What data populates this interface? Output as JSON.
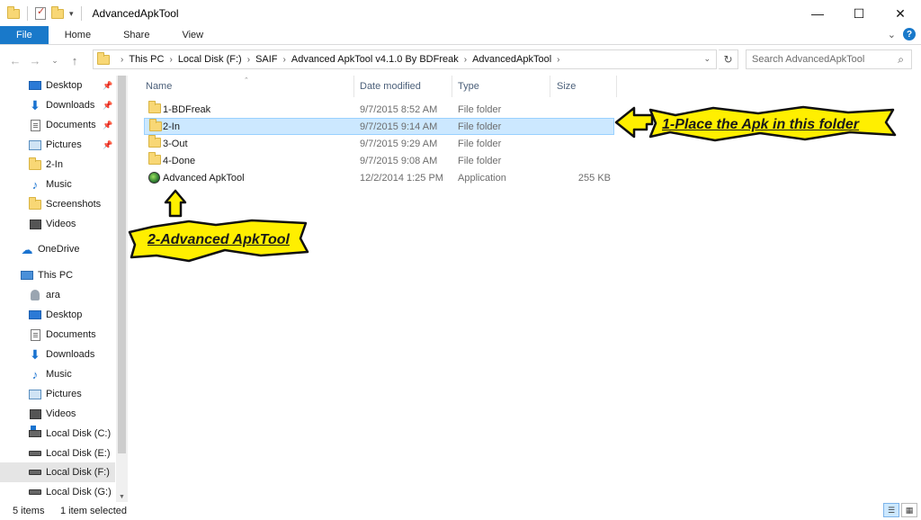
{
  "window": {
    "title": "AdvancedApkTool",
    "controls": {
      "minimize": "—",
      "maximize": "☐",
      "close": "✕"
    }
  },
  "ribbon": {
    "tabs": [
      "File",
      "Home",
      "Share",
      "View"
    ],
    "collapse_icon": "chevron-down-icon",
    "help_label": "?"
  },
  "address": {
    "crumbs": [
      "This PC",
      "Local Disk (F:)",
      "SAIF",
      "Advanced ApkTool v4.1.0 By BDFreak",
      "AdvancedApkTool"
    ],
    "search_placeholder": "Search AdvancedApkTool"
  },
  "nav": {
    "quick_access": [
      {
        "label": "Desktop",
        "icon": "desktop-icon",
        "pinned": true
      },
      {
        "label": "Downloads",
        "icon": "downloads-icon",
        "pinned": true
      },
      {
        "label": "Documents",
        "icon": "documents-icon",
        "pinned": true
      },
      {
        "label": "Pictures",
        "icon": "pictures-icon",
        "pinned": true
      },
      {
        "label": "2-In",
        "icon": "folder-icon",
        "pinned": false
      },
      {
        "label": "Music",
        "icon": "music-icon",
        "pinned": false
      },
      {
        "label": "Screenshots",
        "icon": "folder-icon",
        "pinned": false
      },
      {
        "label": "Videos",
        "icon": "videos-icon",
        "pinned": false
      }
    ],
    "onedrive": "OneDrive",
    "this_pc": "This PC",
    "this_pc_items": [
      {
        "label": "ara",
        "icon": "user-icon"
      },
      {
        "label": "Desktop",
        "icon": "desktop-icon"
      },
      {
        "label": "Documents",
        "icon": "documents-icon"
      },
      {
        "label": "Downloads",
        "icon": "downloads-icon"
      },
      {
        "label": "Music",
        "icon": "music-icon"
      },
      {
        "label": "Pictures",
        "icon": "pictures-icon"
      },
      {
        "label": "Videos",
        "icon": "videos-icon"
      },
      {
        "label": "Local Disk (C:)",
        "icon": "system-drive-icon"
      },
      {
        "label": "Local Disk (E:)",
        "icon": "drive-icon"
      },
      {
        "label": "Local Disk (F:)",
        "icon": "drive-icon",
        "selected": true
      },
      {
        "label": "Local Disk (G:)",
        "icon": "drive-icon"
      }
    ]
  },
  "columns": {
    "name": "Name",
    "date": "Date modified",
    "type": "Type",
    "size": "Size"
  },
  "files": [
    {
      "name": "1-BDFreak",
      "date": "9/7/2015 8:52 AM",
      "type": "File folder",
      "size": "",
      "icon": "folder-icon"
    },
    {
      "name": "2-In",
      "date": "9/7/2015 9:14 AM",
      "type": "File folder",
      "size": "",
      "icon": "folder-icon",
      "selected": true
    },
    {
      "name": "3-Out",
      "date": "9/7/2015 9:29 AM",
      "type": "File folder",
      "size": "",
      "icon": "folder-icon"
    },
    {
      "name": "4-Done",
      "date": "9/7/2015 9:08 AM",
      "type": "File folder",
      "size": "",
      "icon": "folder-icon"
    },
    {
      "name": "Advanced ApkTool",
      "date": "12/2/2014 1:25 PM",
      "type": "Application",
      "size": "255 KB",
      "icon": "app-icon"
    }
  ],
  "callouts": {
    "place_apk": "1-Place the Apk in this folder",
    "advanced_tool": "2-Advanced ApkTool",
    "color": "#ffef00"
  },
  "status": {
    "items": "5 items",
    "selected": "1 item selected"
  },
  "colors": {
    "accent": "#1979ca",
    "selection": "#cce8ff",
    "header_text": "#4c607a"
  }
}
